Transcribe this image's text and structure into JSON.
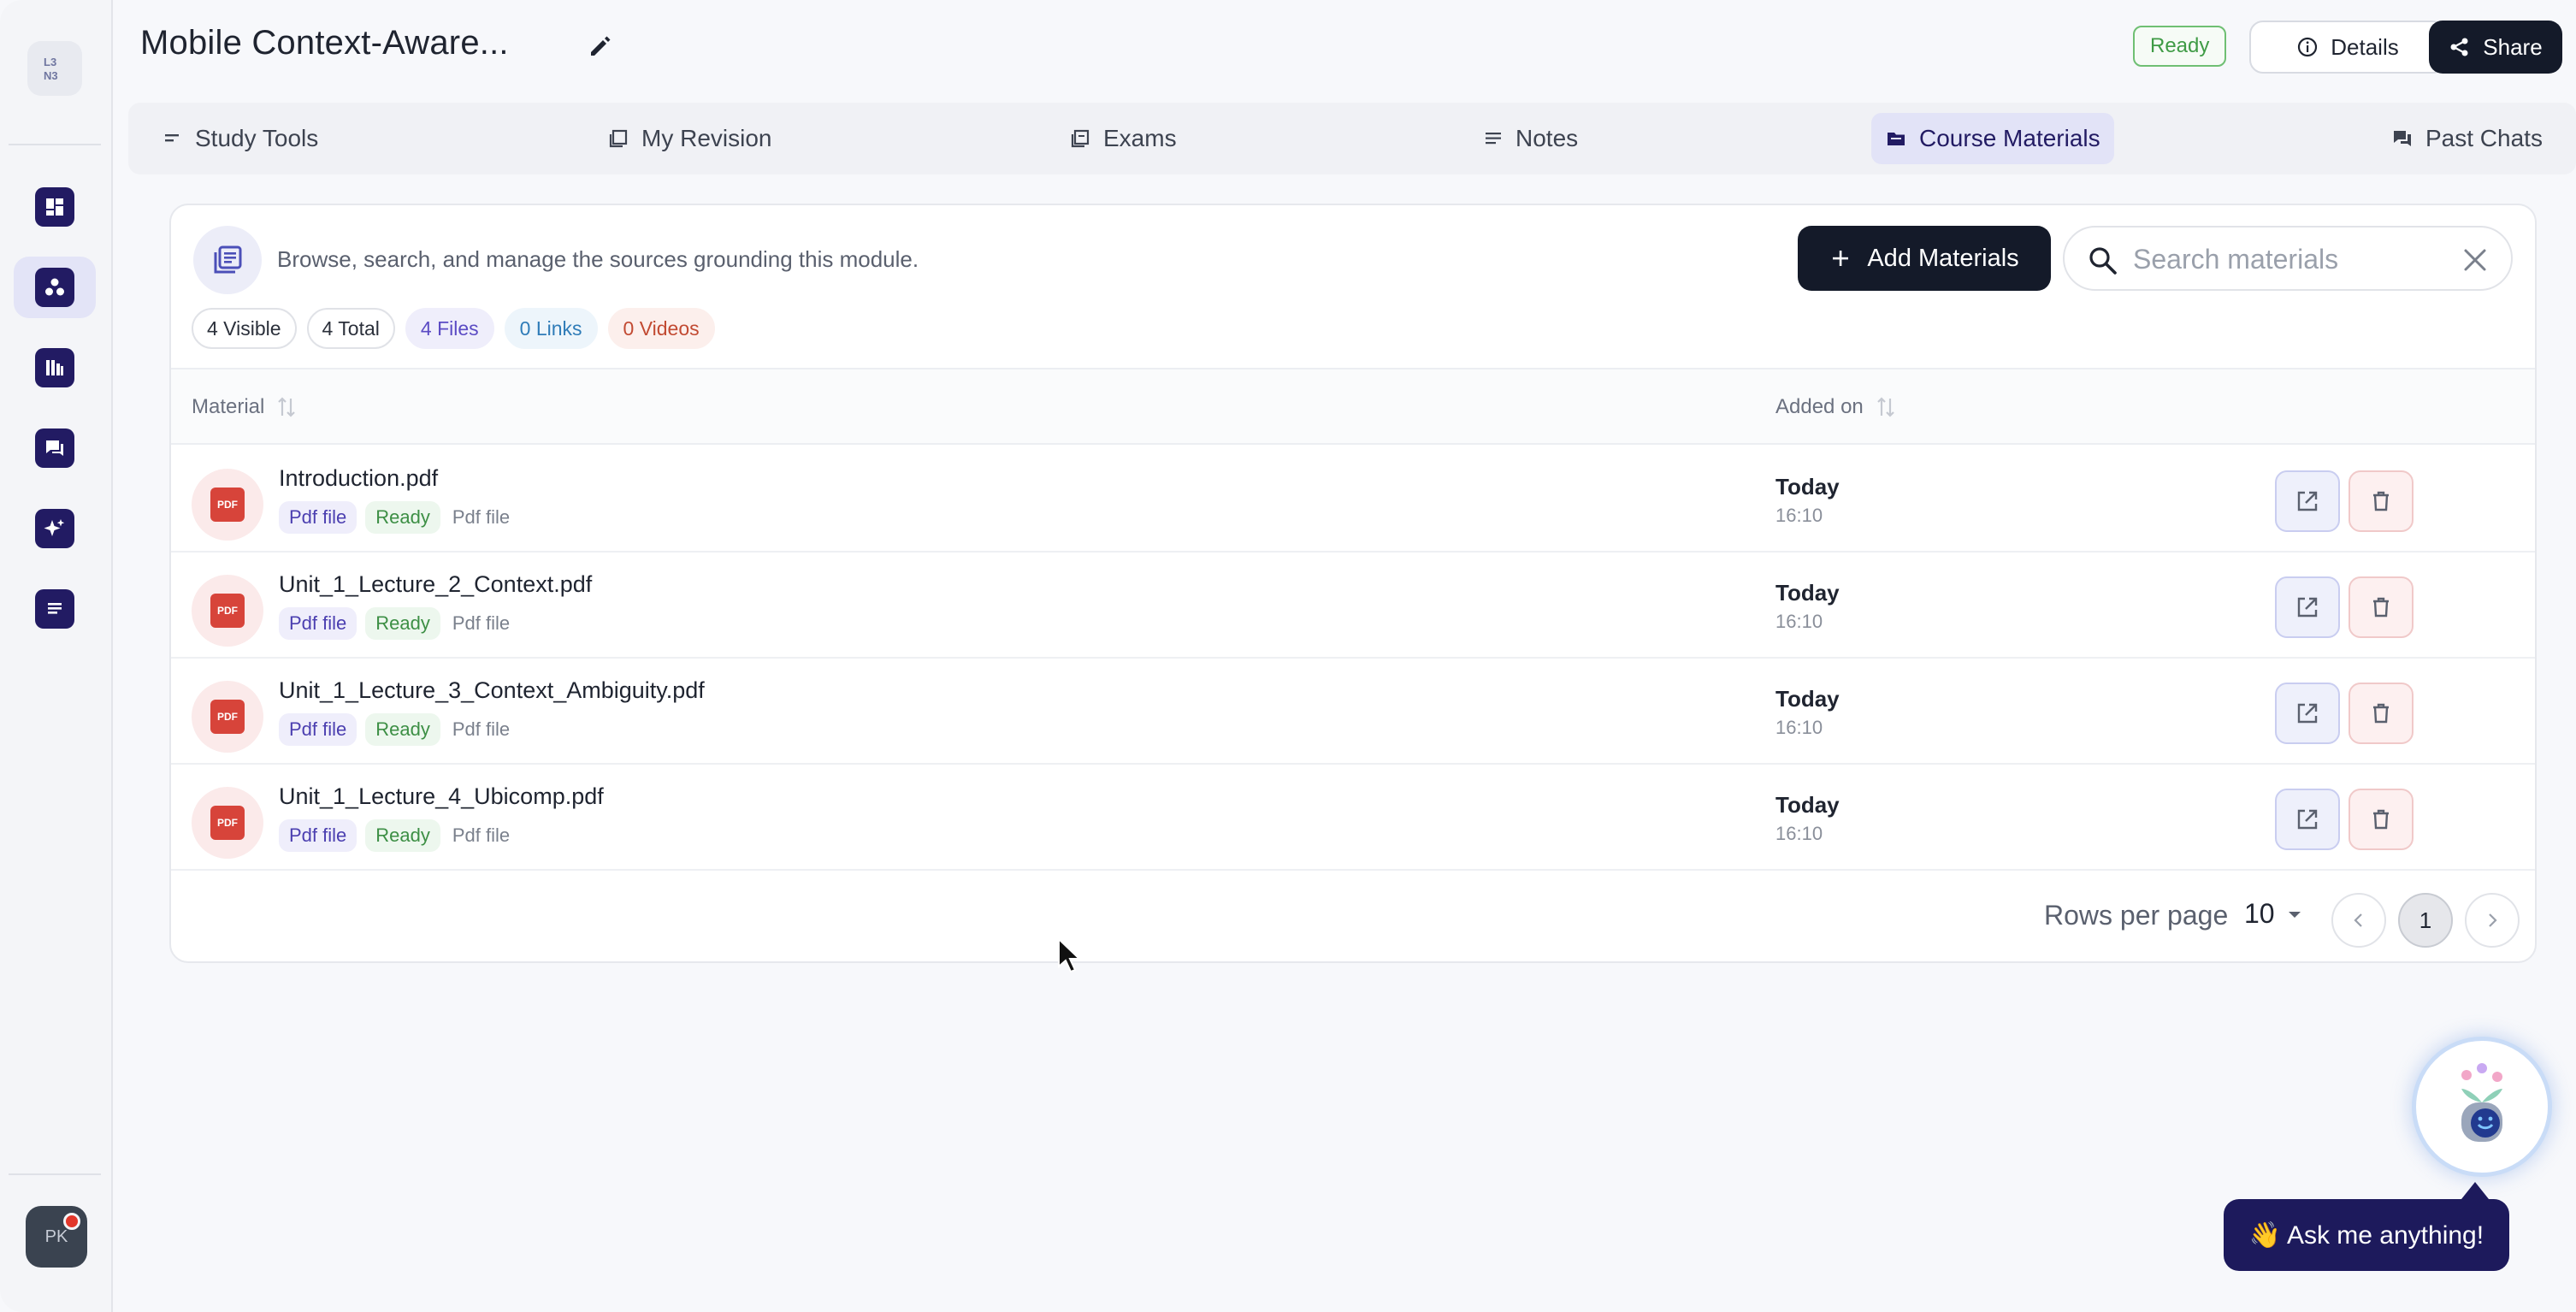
{
  "sidebar": {
    "logo_text": "L3\nN3",
    "avatar_initials": "PK",
    "items": [
      {
        "name": "dashboard-icon"
      },
      {
        "name": "modules-icon"
      },
      {
        "name": "library-icon"
      },
      {
        "name": "chats-icon"
      },
      {
        "name": "sparkle-icon"
      },
      {
        "name": "notes-icon"
      }
    ]
  },
  "header": {
    "title": "Mobile Context-Aware...",
    "status": "Ready",
    "details_label": "Details",
    "share_label": "Share"
  },
  "tabs": [
    {
      "label": "Study Tools",
      "icon": "list-icon"
    },
    {
      "label": "My Revision",
      "icon": "revision-icon"
    },
    {
      "label": "Exams",
      "icon": "exam-icon"
    },
    {
      "label": "Notes",
      "icon": "notes-icon"
    },
    {
      "label": "Course Materials",
      "icon": "folder-icon",
      "active": true
    },
    {
      "label": "Past Chats",
      "icon": "chat-icon"
    }
  ],
  "materials": {
    "description": "Browse, search, and manage the sources grounding this module.",
    "add_label": "Add Materials",
    "search_placeholder": "Search materials",
    "chips": {
      "visible": "4 Visible",
      "total": "4 Total",
      "files": "4 Files",
      "links": "0 Links",
      "videos": "0 Videos"
    },
    "columns": {
      "material": "Material",
      "added_on": "Added on"
    },
    "rows": [
      {
        "name": "Introduction.pdf",
        "type": "Pdf file",
        "status": "Ready",
        "kind": "Pdf file",
        "date": "Today",
        "time": "16:10"
      },
      {
        "name": "Unit_1_Lecture_2_Context.pdf",
        "type": "Pdf file",
        "status": "Ready",
        "kind": "Pdf file",
        "date": "Today",
        "time": "16:10"
      },
      {
        "name": "Unit_1_Lecture_3_Context_Ambiguity.pdf",
        "type": "Pdf file",
        "status": "Ready",
        "kind": "Pdf file",
        "date": "Today",
        "time": "16:10"
      },
      {
        "name": "Unit_1_Lecture_4_Ubicomp.pdf",
        "type": "Pdf file",
        "status": "Ready",
        "kind": "Pdf file",
        "date": "Today",
        "time": "16:10"
      }
    ],
    "pagination": {
      "rows_per_page_label": "Rows per page",
      "rows_per_page": "10",
      "current_page": "1"
    }
  },
  "assistant": {
    "label": "👋 Ask me anything!"
  },
  "pdf_badge_text": "PDF",
  "colors": {
    "primary": "#221b63",
    "dark": "#141a29",
    "ready": "#3f9b46",
    "pdf": "#d7443a"
  }
}
